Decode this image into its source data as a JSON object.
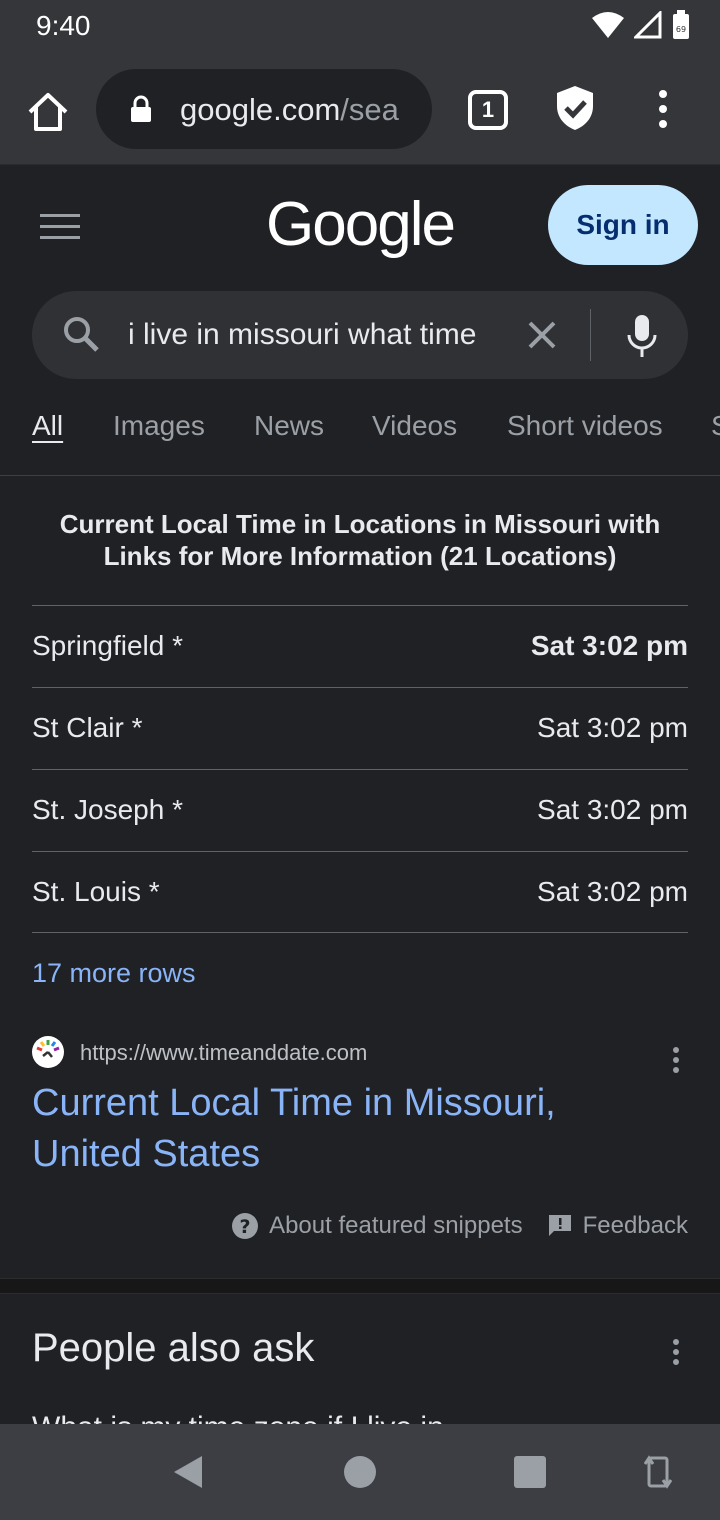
{
  "status_bar": {
    "time": "9:40",
    "battery": "69"
  },
  "browser": {
    "url_domain": "google.com",
    "url_path": "/sea",
    "tab_count": "1"
  },
  "header": {
    "logo": "Google",
    "sign_in": "Sign in"
  },
  "search": {
    "query": "i live in missouri what time"
  },
  "tabs": [
    "All",
    "Images",
    "News",
    "Videos",
    "Short videos",
    "S"
  ],
  "snippet": {
    "title": "Current Local Time in Locations in Missouri with Links for More Information (21 Locations)",
    "rows": [
      {
        "location": "Springfield *",
        "time": "Sat 3:02 pm"
      },
      {
        "location": "St Clair *",
        "time": "Sat 3:02 pm"
      },
      {
        "location": "St. Joseph *",
        "time": "Sat 3:02 pm"
      },
      {
        "location": "St. Louis *",
        "time": "Sat 3:02 pm"
      }
    ],
    "more_rows": "17 more rows",
    "source_url": "https://www.timeanddate.com",
    "result_title": "Current Local Time in Missouri, United States",
    "about_label": "About featured snippets",
    "feedback_label": "Feedback"
  },
  "people_also_ask": {
    "title": "People also ask",
    "peek_text": "What is my time zone if I live in"
  },
  "colors": {
    "background": "#202124",
    "toolbar": "#35363a",
    "link": "#8ab4f8",
    "signin_bg": "#c2e7ff"
  }
}
